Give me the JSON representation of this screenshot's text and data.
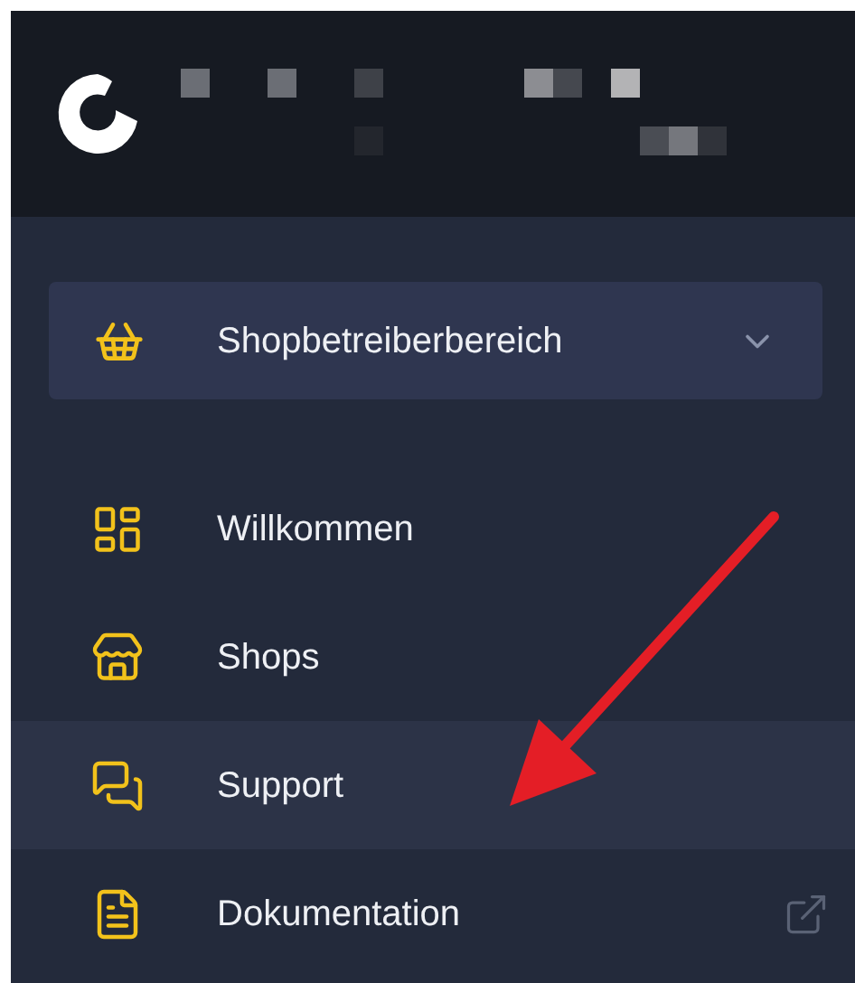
{
  "area_switcher": {
    "label": "Shopbetreiberbereich",
    "expanded": false
  },
  "nav_items": [
    {
      "label": "Willkommen",
      "selected": false,
      "external": false
    },
    {
      "label": "Shops",
      "selected": false,
      "external": false
    },
    {
      "label": "Support",
      "selected": true,
      "external": false
    },
    {
      "label": "Dokumentation",
      "selected": false,
      "external": true
    }
  ]
}
